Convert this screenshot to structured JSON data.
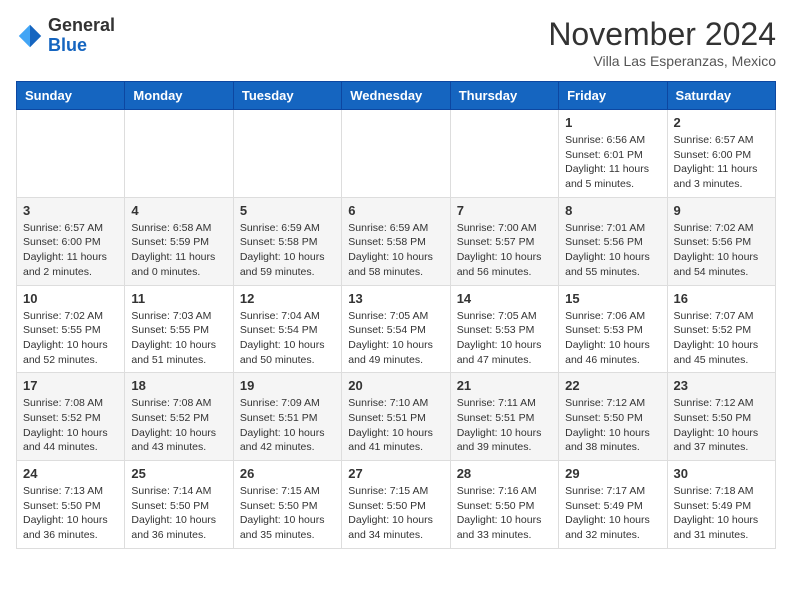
{
  "header": {
    "logo": {
      "general": "General",
      "blue": "Blue"
    },
    "month": "November 2024",
    "location": "Villa Las Esperanzas, Mexico"
  },
  "weekdays": [
    "Sunday",
    "Monday",
    "Tuesday",
    "Wednesday",
    "Thursday",
    "Friday",
    "Saturday"
  ],
  "weeks": [
    [
      {
        "day": "",
        "info": ""
      },
      {
        "day": "",
        "info": ""
      },
      {
        "day": "",
        "info": ""
      },
      {
        "day": "",
        "info": ""
      },
      {
        "day": "",
        "info": ""
      },
      {
        "day": "1",
        "info": "Sunrise: 6:56 AM\nSunset: 6:01 PM\nDaylight: 11 hours\nand 5 minutes."
      },
      {
        "day": "2",
        "info": "Sunrise: 6:57 AM\nSunset: 6:00 PM\nDaylight: 11 hours\nand 3 minutes."
      }
    ],
    [
      {
        "day": "3",
        "info": "Sunrise: 6:57 AM\nSunset: 6:00 PM\nDaylight: 11 hours\nand 2 minutes."
      },
      {
        "day": "4",
        "info": "Sunrise: 6:58 AM\nSunset: 5:59 PM\nDaylight: 11 hours\nand 0 minutes."
      },
      {
        "day": "5",
        "info": "Sunrise: 6:59 AM\nSunset: 5:58 PM\nDaylight: 10 hours\nand 59 minutes."
      },
      {
        "day": "6",
        "info": "Sunrise: 6:59 AM\nSunset: 5:58 PM\nDaylight: 10 hours\nand 58 minutes."
      },
      {
        "day": "7",
        "info": "Sunrise: 7:00 AM\nSunset: 5:57 PM\nDaylight: 10 hours\nand 56 minutes."
      },
      {
        "day": "8",
        "info": "Sunrise: 7:01 AM\nSunset: 5:56 PM\nDaylight: 10 hours\nand 55 minutes."
      },
      {
        "day": "9",
        "info": "Sunrise: 7:02 AM\nSunset: 5:56 PM\nDaylight: 10 hours\nand 54 minutes."
      }
    ],
    [
      {
        "day": "10",
        "info": "Sunrise: 7:02 AM\nSunset: 5:55 PM\nDaylight: 10 hours\nand 52 minutes."
      },
      {
        "day": "11",
        "info": "Sunrise: 7:03 AM\nSunset: 5:55 PM\nDaylight: 10 hours\nand 51 minutes."
      },
      {
        "day": "12",
        "info": "Sunrise: 7:04 AM\nSunset: 5:54 PM\nDaylight: 10 hours\nand 50 minutes."
      },
      {
        "day": "13",
        "info": "Sunrise: 7:05 AM\nSunset: 5:54 PM\nDaylight: 10 hours\nand 49 minutes."
      },
      {
        "day": "14",
        "info": "Sunrise: 7:05 AM\nSunset: 5:53 PM\nDaylight: 10 hours\nand 47 minutes."
      },
      {
        "day": "15",
        "info": "Sunrise: 7:06 AM\nSunset: 5:53 PM\nDaylight: 10 hours\nand 46 minutes."
      },
      {
        "day": "16",
        "info": "Sunrise: 7:07 AM\nSunset: 5:52 PM\nDaylight: 10 hours\nand 45 minutes."
      }
    ],
    [
      {
        "day": "17",
        "info": "Sunrise: 7:08 AM\nSunset: 5:52 PM\nDaylight: 10 hours\nand 44 minutes."
      },
      {
        "day": "18",
        "info": "Sunrise: 7:08 AM\nSunset: 5:52 PM\nDaylight: 10 hours\nand 43 minutes."
      },
      {
        "day": "19",
        "info": "Sunrise: 7:09 AM\nSunset: 5:51 PM\nDaylight: 10 hours\nand 42 minutes."
      },
      {
        "day": "20",
        "info": "Sunrise: 7:10 AM\nSunset: 5:51 PM\nDaylight: 10 hours\nand 41 minutes."
      },
      {
        "day": "21",
        "info": "Sunrise: 7:11 AM\nSunset: 5:51 PM\nDaylight: 10 hours\nand 39 minutes."
      },
      {
        "day": "22",
        "info": "Sunrise: 7:12 AM\nSunset: 5:50 PM\nDaylight: 10 hours\nand 38 minutes."
      },
      {
        "day": "23",
        "info": "Sunrise: 7:12 AM\nSunset: 5:50 PM\nDaylight: 10 hours\nand 37 minutes."
      }
    ],
    [
      {
        "day": "24",
        "info": "Sunrise: 7:13 AM\nSunset: 5:50 PM\nDaylight: 10 hours\nand 36 minutes."
      },
      {
        "day": "25",
        "info": "Sunrise: 7:14 AM\nSunset: 5:50 PM\nDaylight: 10 hours\nand 36 minutes."
      },
      {
        "day": "26",
        "info": "Sunrise: 7:15 AM\nSunset: 5:50 PM\nDaylight: 10 hours\nand 35 minutes."
      },
      {
        "day": "27",
        "info": "Sunrise: 7:15 AM\nSunset: 5:50 PM\nDaylight: 10 hours\nand 34 minutes."
      },
      {
        "day": "28",
        "info": "Sunrise: 7:16 AM\nSunset: 5:50 PM\nDaylight: 10 hours\nand 33 minutes."
      },
      {
        "day": "29",
        "info": "Sunrise: 7:17 AM\nSunset: 5:49 PM\nDaylight: 10 hours\nand 32 minutes."
      },
      {
        "day": "30",
        "info": "Sunrise: 7:18 AM\nSunset: 5:49 PM\nDaylight: 10 hours\nand 31 minutes."
      }
    ]
  ]
}
